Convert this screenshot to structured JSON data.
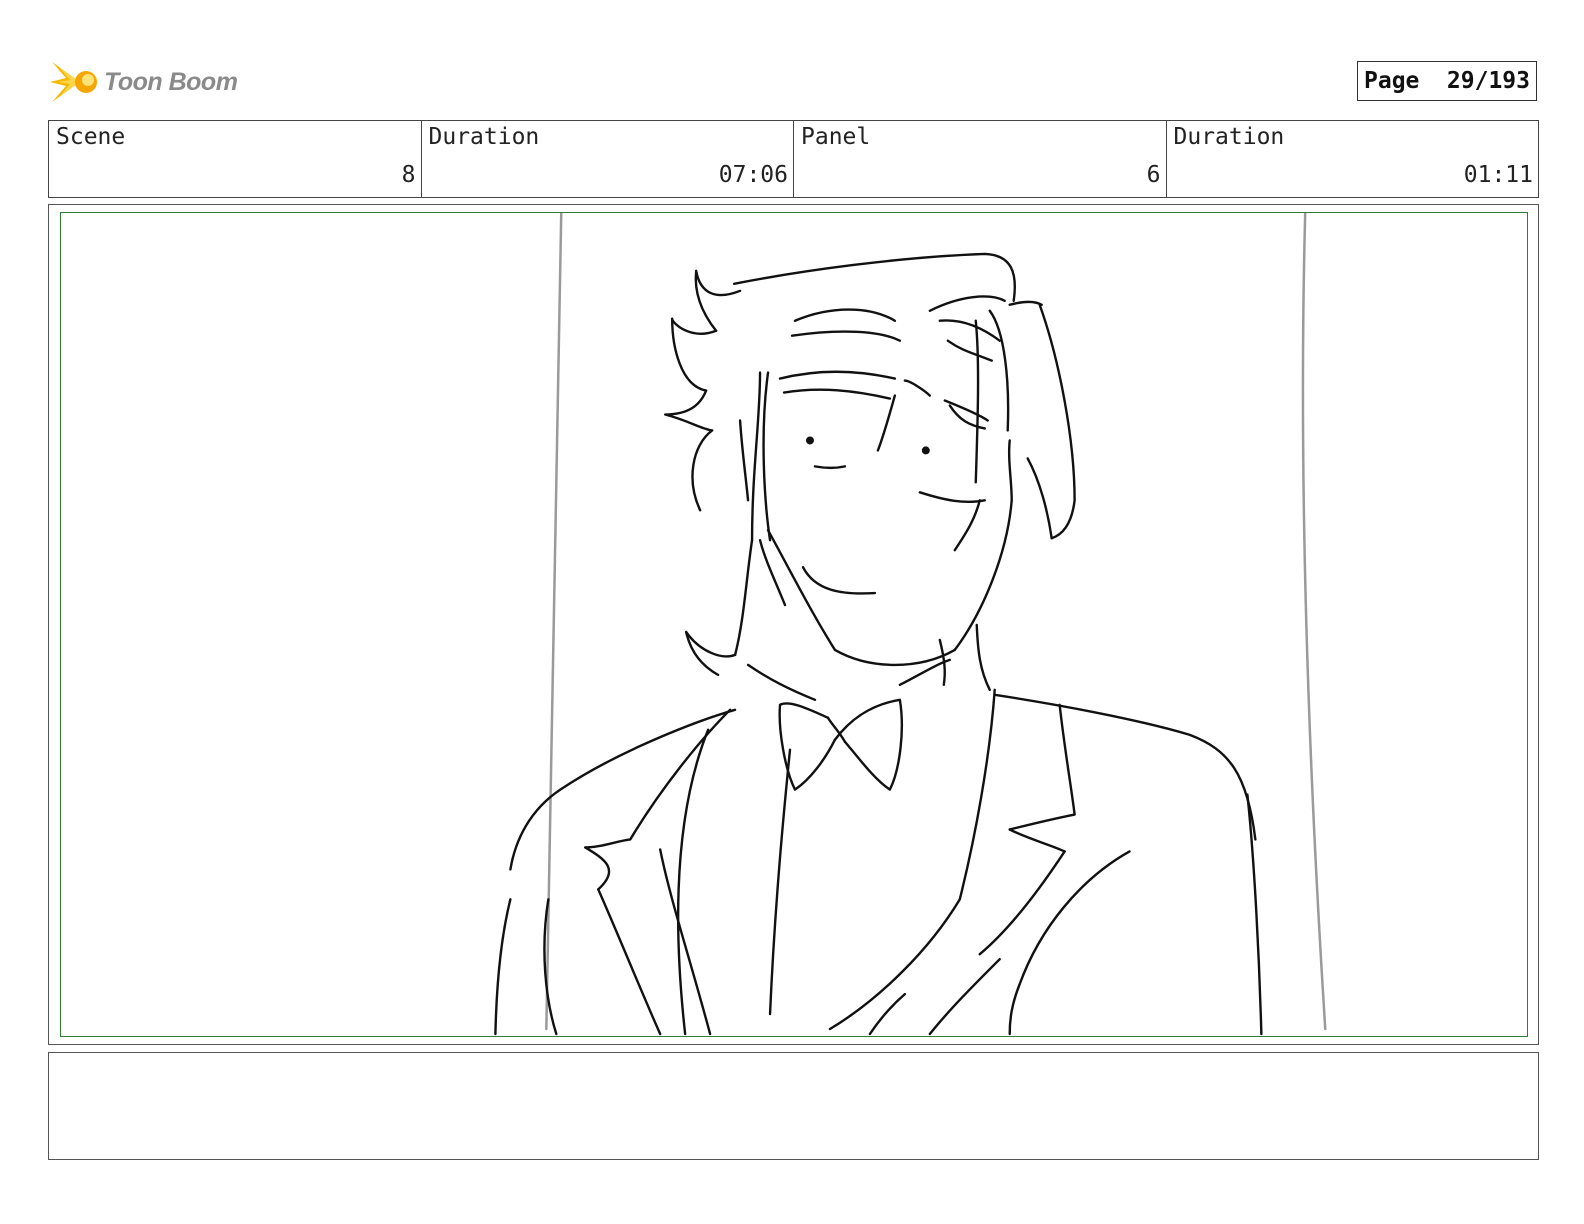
{
  "header": {
    "logo_text": "Toon Boom",
    "page_label": "Page",
    "page_value": "29/193"
  },
  "info": {
    "scene_label": "Scene",
    "scene_value": "8",
    "scene_duration_label": "Duration",
    "scene_duration_value": "07:06",
    "panel_label": "Panel",
    "panel_value": "6",
    "panel_duration_label": "Duration",
    "panel_duration_value": "01:11"
  },
  "panel": {
    "frame_color": "#2e7d32",
    "sketch_color": "#111111",
    "guide_color": "#9a9a9a"
  },
  "notes": {
    "text": ""
  }
}
